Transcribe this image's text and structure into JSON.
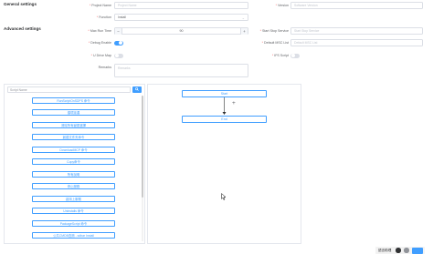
{
  "general": {
    "title": "General settings",
    "project_name_label": "Project Name",
    "project_name_placeholder": "Project Name",
    "version_label": "Version",
    "version_placeholder": "Software Version",
    "function_label": "Function",
    "function_value": "Install"
  },
  "advanced": {
    "title": "Advanced settings",
    "max_run_time_label": "Max Run Time",
    "max_run_time_value": "90",
    "start_stop_service_label": "Start Stop Service",
    "start_stop_service_placeholder": "Start Stop Service",
    "debug_enable_label": "Debug Enable",
    "debug_enable_on": true,
    "default_msc_list_label": "Default MSC List",
    "default_msc_list_placeholder": "Default MSC List",
    "u_drive_map_label": "U Drive Map",
    "u_drive_map_on": false,
    "ifs_script_label": "IFS Script",
    "ifs_script_on": false,
    "remarks_label": "Remarks",
    "remarks_placeholder": "Remarks"
  },
  "script_panel": {
    "search_placeholder": "Script Name",
    "items": [
      "RunScriptOnSDPS 命令",
      "循環延遲",
      "清除所有變更選擇",
      "創建文件夾命令",
      "DownloadMCP 命令",
      "Copy命令",
      "所有說明",
      "停止服務",
      "啟用上服務",
      "Uninstalls 命令",
      "PackageScript 命令",
      "公共CMDB查詢 - sdbar Install"
    ]
  },
  "flow": {
    "start_label": "Start",
    "end_label": "End",
    "add_symbol": "+"
  },
  "footer": {
    "text": "語言助理"
  },
  "colors": {
    "accent": "#409eff",
    "border": "#dcdfe6",
    "required": "#f56c6c"
  }
}
